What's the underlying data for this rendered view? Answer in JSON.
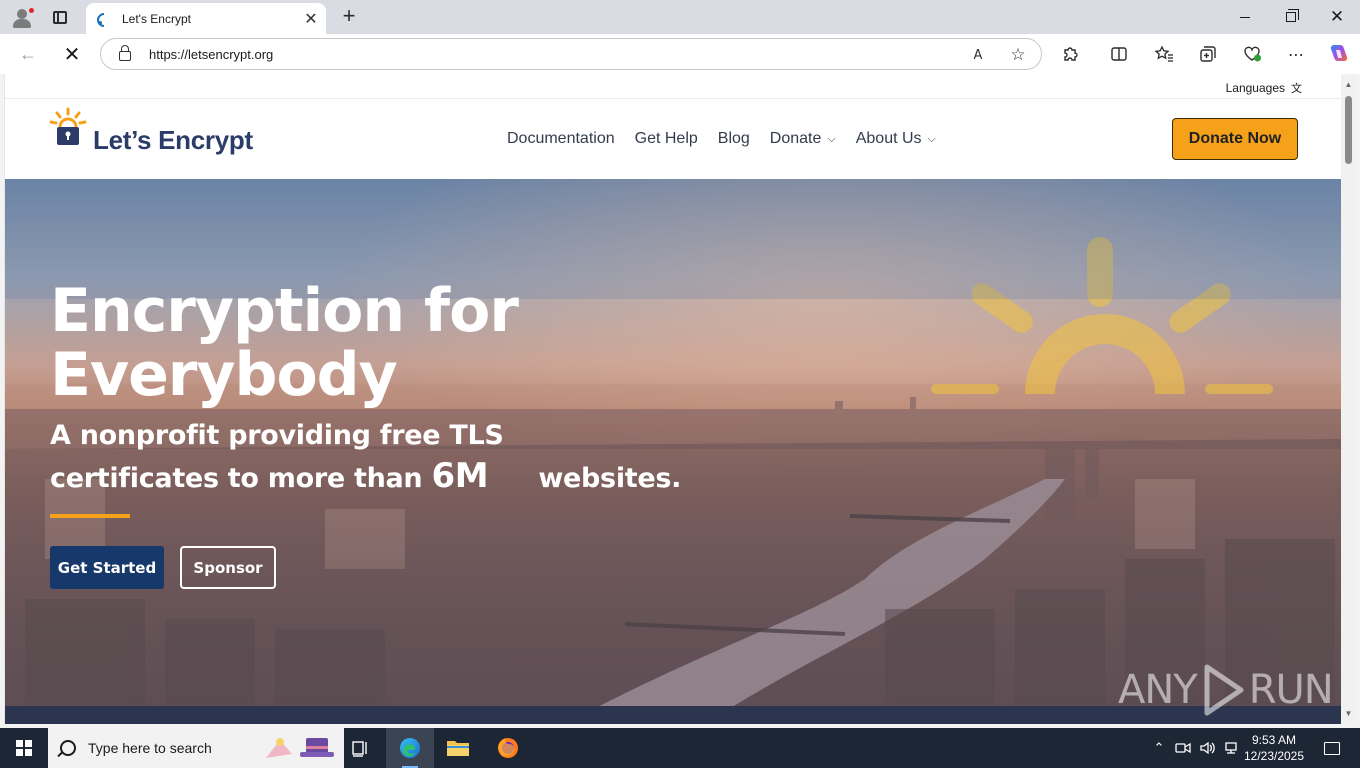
{
  "browser": {
    "tab_title": "Let's Encrypt",
    "tab_close": "✕",
    "new_tab": "+",
    "url": "https://letsencrypt.org",
    "icons": {
      "back": "arrow-left-icon",
      "stop": "stop-loading-icon",
      "read_aloud": "read-aloud-icon",
      "favorite": "star-icon",
      "extensions": "puzzle-icon",
      "split": "split-screen-icon",
      "favorites": "favorites-icon",
      "collections": "collections-icon",
      "browser_essentials": "heart-pulse-icon",
      "more": "ellipsis-icon",
      "copilot": "copilot-icon"
    },
    "glyphs": {
      "back": "←",
      "stop": "✕",
      "read_aloud": "A",
      "favorite": "☆",
      "extensions": "⧉",
      "split": "◫",
      "favorites": "✩",
      "collections": "⊞",
      "essentials": "♥",
      "more": "⋯"
    }
  },
  "page": {
    "languages_label": "Languages",
    "languages_icon": "translate-icon",
    "brand": "Let’s Encrypt",
    "nav": [
      {
        "label": "Documentation"
      },
      {
        "label": "Get Help"
      },
      {
        "label": "Blog"
      },
      {
        "label": "Donate",
        "dropdown": true
      },
      {
        "label": "About Us",
        "dropdown": true
      }
    ],
    "donate_now": "Donate Now",
    "hero": {
      "title": "Encryption for Everybody",
      "subtitle_line1": "A nonprofit providing free TLS",
      "subtitle_pre": "certificates to more than ",
      "subtitle_count": "6M",
      "subtitle_post": "websites.",
      "get_started": "Get Started",
      "sponsor": "Sponsor"
    },
    "watermark_left": "ANY",
    "watermark_right": "RUN"
  },
  "colors": {
    "brand_navy": "#2c3c69",
    "accent_orange": "#f6a11a",
    "button_navy": "#16386b"
  },
  "taskbar": {
    "search_placeholder": "Type here to search",
    "time": "9:53 AM",
    "date": "12/23/2025",
    "icons": {
      "start": "windows-logo-icon",
      "task_view": "task-view-icon",
      "edge": "edge-browser-icon",
      "explorer": "file-explorer-icon",
      "firefox": "firefox-icon",
      "chevron": "chevron-up-icon",
      "meet": "meet-now-icon",
      "volume": "speaker-icon",
      "network": "network-icon",
      "notifications": "notification-icon"
    }
  }
}
